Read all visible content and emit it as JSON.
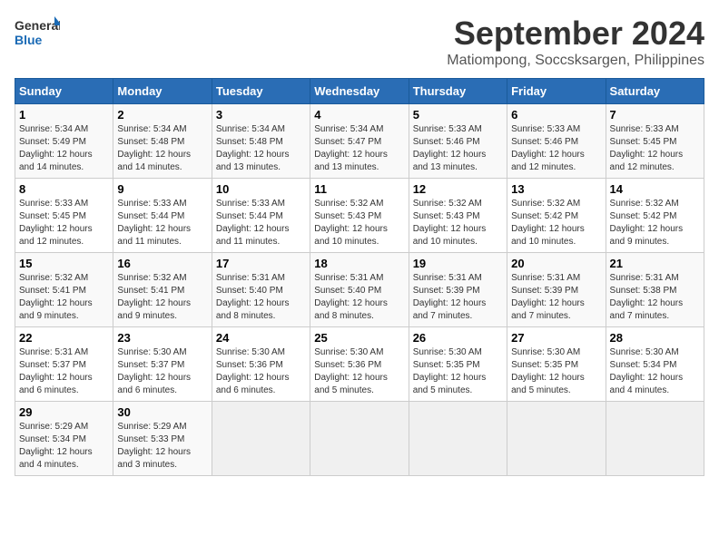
{
  "logo": {
    "line1": "General",
    "line2": "Blue"
  },
  "title": "September 2024",
  "subtitle": "Matiompong, Soccsksargen, Philippines",
  "days_of_week": [
    "Sunday",
    "Monday",
    "Tuesday",
    "Wednesday",
    "Thursday",
    "Friday",
    "Saturday"
  ],
  "weeks": [
    [
      {
        "day": "1",
        "sunrise": "5:34 AM",
        "sunset": "5:49 PM",
        "daylight": "12 hours and 14 minutes."
      },
      {
        "day": "2",
        "sunrise": "5:34 AM",
        "sunset": "5:48 PM",
        "daylight": "12 hours and 14 minutes."
      },
      {
        "day": "3",
        "sunrise": "5:34 AM",
        "sunset": "5:48 PM",
        "daylight": "12 hours and 13 minutes."
      },
      {
        "day": "4",
        "sunrise": "5:34 AM",
        "sunset": "5:47 PM",
        "daylight": "12 hours and 13 minutes."
      },
      {
        "day": "5",
        "sunrise": "5:33 AM",
        "sunset": "5:46 PM",
        "daylight": "12 hours and 13 minutes."
      },
      {
        "day": "6",
        "sunrise": "5:33 AM",
        "sunset": "5:46 PM",
        "daylight": "12 hours and 12 minutes."
      },
      {
        "day": "7",
        "sunrise": "5:33 AM",
        "sunset": "5:45 PM",
        "daylight": "12 hours and 12 minutes."
      }
    ],
    [
      {
        "day": "8",
        "sunrise": "5:33 AM",
        "sunset": "5:45 PM",
        "daylight": "12 hours and 12 minutes."
      },
      {
        "day": "9",
        "sunrise": "5:33 AM",
        "sunset": "5:44 PM",
        "daylight": "12 hours and 11 minutes."
      },
      {
        "day": "10",
        "sunrise": "5:33 AM",
        "sunset": "5:44 PM",
        "daylight": "12 hours and 11 minutes."
      },
      {
        "day": "11",
        "sunrise": "5:32 AM",
        "sunset": "5:43 PM",
        "daylight": "12 hours and 10 minutes."
      },
      {
        "day": "12",
        "sunrise": "5:32 AM",
        "sunset": "5:43 PM",
        "daylight": "12 hours and 10 minutes."
      },
      {
        "day": "13",
        "sunrise": "5:32 AM",
        "sunset": "5:42 PM",
        "daylight": "12 hours and 10 minutes."
      },
      {
        "day": "14",
        "sunrise": "5:32 AM",
        "sunset": "5:42 PM",
        "daylight": "12 hours and 9 minutes."
      }
    ],
    [
      {
        "day": "15",
        "sunrise": "5:32 AM",
        "sunset": "5:41 PM",
        "daylight": "12 hours and 9 minutes."
      },
      {
        "day": "16",
        "sunrise": "5:32 AM",
        "sunset": "5:41 PM",
        "daylight": "12 hours and 9 minutes."
      },
      {
        "day": "17",
        "sunrise": "5:31 AM",
        "sunset": "5:40 PM",
        "daylight": "12 hours and 8 minutes."
      },
      {
        "day": "18",
        "sunrise": "5:31 AM",
        "sunset": "5:40 PM",
        "daylight": "12 hours and 8 minutes."
      },
      {
        "day": "19",
        "sunrise": "5:31 AM",
        "sunset": "5:39 PM",
        "daylight": "12 hours and 7 minutes."
      },
      {
        "day": "20",
        "sunrise": "5:31 AM",
        "sunset": "5:39 PM",
        "daylight": "12 hours and 7 minutes."
      },
      {
        "day": "21",
        "sunrise": "5:31 AM",
        "sunset": "5:38 PM",
        "daylight": "12 hours and 7 minutes."
      }
    ],
    [
      {
        "day": "22",
        "sunrise": "5:31 AM",
        "sunset": "5:37 PM",
        "daylight": "12 hours and 6 minutes."
      },
      {
        "day": "23",
        "sunrise": "5:30 AM",
        "sunset": "5:37 PM",
        "daylight": "12 hours and 6 minutes."
      },
      {
        "day": "24",
        "sunrise": "5:30 AM",
        "sunset": "5:36 PM",
        "daylight": "12 hours and 6 minutes."
      },
      {
        "day": "25",
        "sunrise": "5:30 AM",
        "sunset": "5:36 PM",
        "daylight": "12 hours and 5 minutes."
      },
      {
        "day": "26",
        "sunrise": "5:30 AM",
        "sunset": "5:35 PM",
        "daylight": "12 hours and 5 minutes."
      },
      {
        "day": "27",
        "sunrise": "5:30 AM",
        "sunset": "5:35 PM",
        "daylight": "12 hours and 5 minutes."
      },
      {
        "day": "28",
        "sunrise": "5:30 AM",
        "sunset": "5:34 PM",
        "daylight": "12 hours and 4 minutes."
      }
    ],
    [
      {
        "day": "29",
        "sunrise": "5:29 AM",
        "sunset": "5:34 PM",
        "daylight": "12 hours and 4 minutes."
      },
      {
        "day": "30",
        "sunrise": "5:29 AM",
        "sunset": "5:33 PM",
        "daylight": "12 hours and 3 minutes."
      },
      null,
      null,
      null,
      null,
      null
    ]
  ]
}
